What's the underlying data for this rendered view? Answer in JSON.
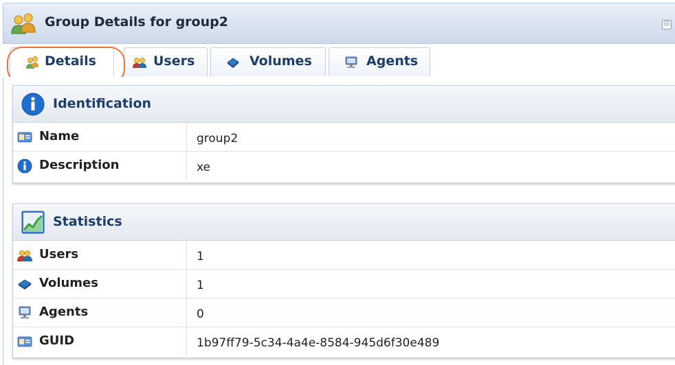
{
  "window": {
    "title": "Group Details for group2",
    "collapse_glyph": "⊟"
  },
  "tabs": [
    {
      "label": "Details",
      "icon": "group-icon",
      "active": true
    },
    {
      "label": "Users",
      "icon": "users-icon",
      "active": false
    },
    {
      "label": "Volumes",
      "icon": "volume-icon",
      "active": false
    },
    {
      "label": "Agents",
      "icon": "agent-icon",
      "active": false
    }
  ],
  "identification": {
    "title": "Identification",
    "icon": "info-icon",
    "rows": [
      {
        "label": "Name",
        "value": "group2",
        "icon": "id-card-icon"
      },
      {
        "label": "Description",
        "value": "xe",
        "icon": "info-icon"
      }
    ]
  },
  "statistics": {
    "title": "Statistics",
    "icon": "chart-icon",
    "rows": [
      {
        "label": "Users",
        "value": "1",
        "icon": "users-icon"
      },
      {
        "label": "Volumes",
        "value": "1",
        "icon": "volume-icon"
      },
      {
        "label": "Agents",
        "value": "0",
        "icon": "agent-icon"
      },
      {
        "label": "GUID",
        "value": "1b97ff79-5c34-4a4e-8584-945d6f30e489",
        "icon": "id-card-icon"
      }
    ]
  },
  "colors": {
    "accent": "#1d3d6b",
    "highlight": "#e8743b",
    "info_blue": "#1f6fd1"
  }
}
